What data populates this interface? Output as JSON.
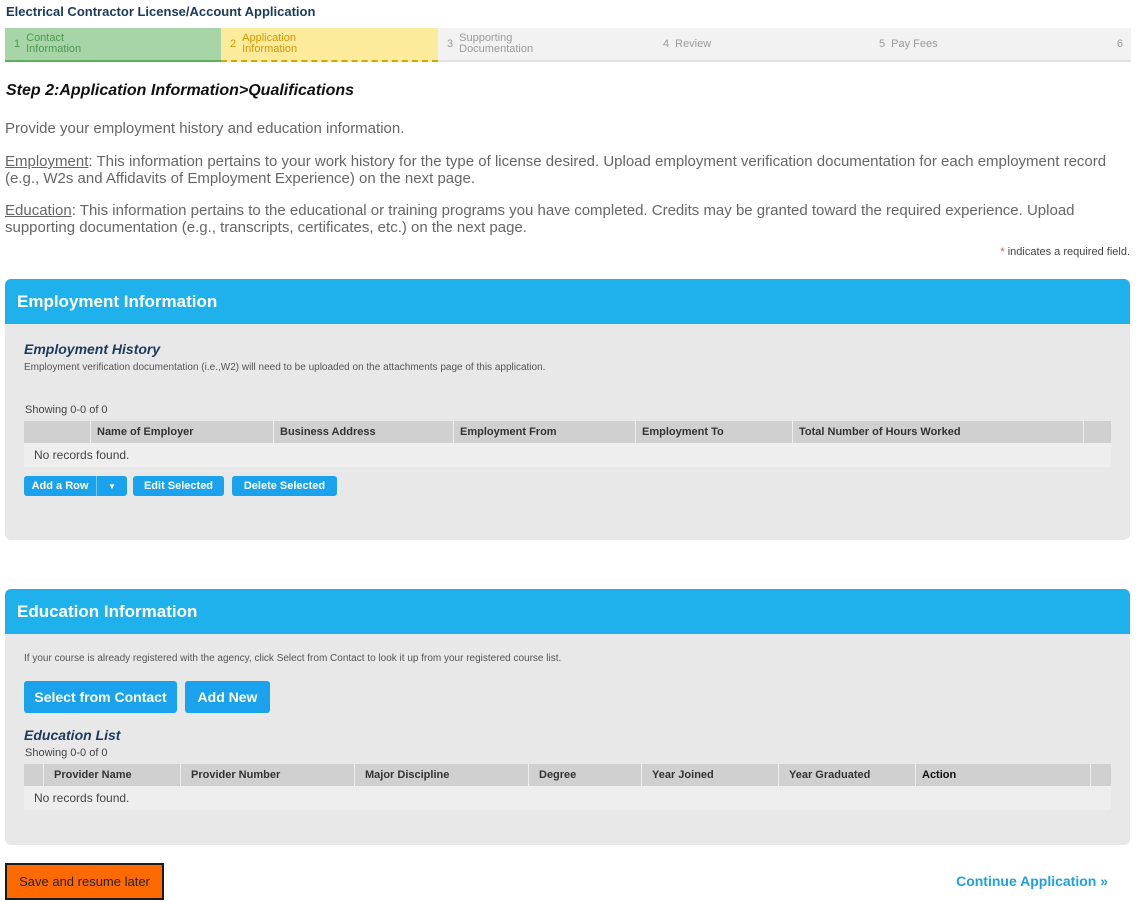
{
  "app": {
    "title": "Electrical Contractor License/Account Application"
  },
  "steps": [
    {
      "num": "1",
      "label": "Contact Information"
    },
    {
      "num": "2",
      "label": "Application Information"
    },
    {
      "num": "3",
      "label": "Supporting Documentation"
    },
    {
      "num": "4",
      "label": "Review"
    },
    {
      "num": "5",
      "label": "Pay Fees"
    },
    {
      "num": "6",
      "label": ""
    }
  ],
  "page": {
    "heading": "Step 2:Application Information>Qualifications",
    "intro": "Provide your employment history and education information.",
    "employment_term": "Employment",
    "employment_text": ": This information pertains to your work history for the type of license desired. Upload employment verification documentation for each employment record (e.g., W2s and Affidavits of Employment Experience) on the next page.",
    "education_term": "Education",
    "education_text": ": This information pertains to the educational or training programs you have completed. Credits may be granted toward the required experience. Upload supporting documentation (e.g., transcripts, certificates, etc.) on the next page.",
    "required_star": "*",
    "required_note": "indicates a required field."
  },
  "employment": {
    "header": "Employment Information",
    "subtitle": "Employment History",
    "note": "Employment verification documentation (i.e.,W2) will need to be uploaded on the attachments page of this application.",
    "showing": "Showing 0-0 of 0",
    "columns": [
      "Name of Employer",
      "Business Address",
      "Employment From",
      "Employment To",
      "Total Number of Hours Worked"
    ],
    "empty": "No records found.",
    "add_row": "Add a Row",
    "edit_selected": "Edit Selected",
    "delete_selected": "Delete Selected"
  },
  "education": {
    "header": "Education Information",
    "note": "If your course is already registered with the agency, click Select from Contact to look it up from your registered course list.",
    "select_contact": "Select from Contact",
    "add_new": "Add New",
    "subtitle": "Education List",
    "showing": "Showing 0-0 of 0",
    "columns": [
      "Provider Name",
      "Provider Number",
      "Major Discipline",
      "Degree",
      "Year Joined",
      "Year Graduated",
      "Action"
    ],
    "empty": "No records found."
  },
  "footer": {
    "save": "Save and resume later",
    "continue": "Continue Application »"
  },
  "colors": {
    "accent": "#1fb1ec",
    "button": "#1aa3ec",
    "save": "#ff6a00",
    "step_done": "#a8d5a8",
    "step_current": "#fdeb9c"
  }
}
